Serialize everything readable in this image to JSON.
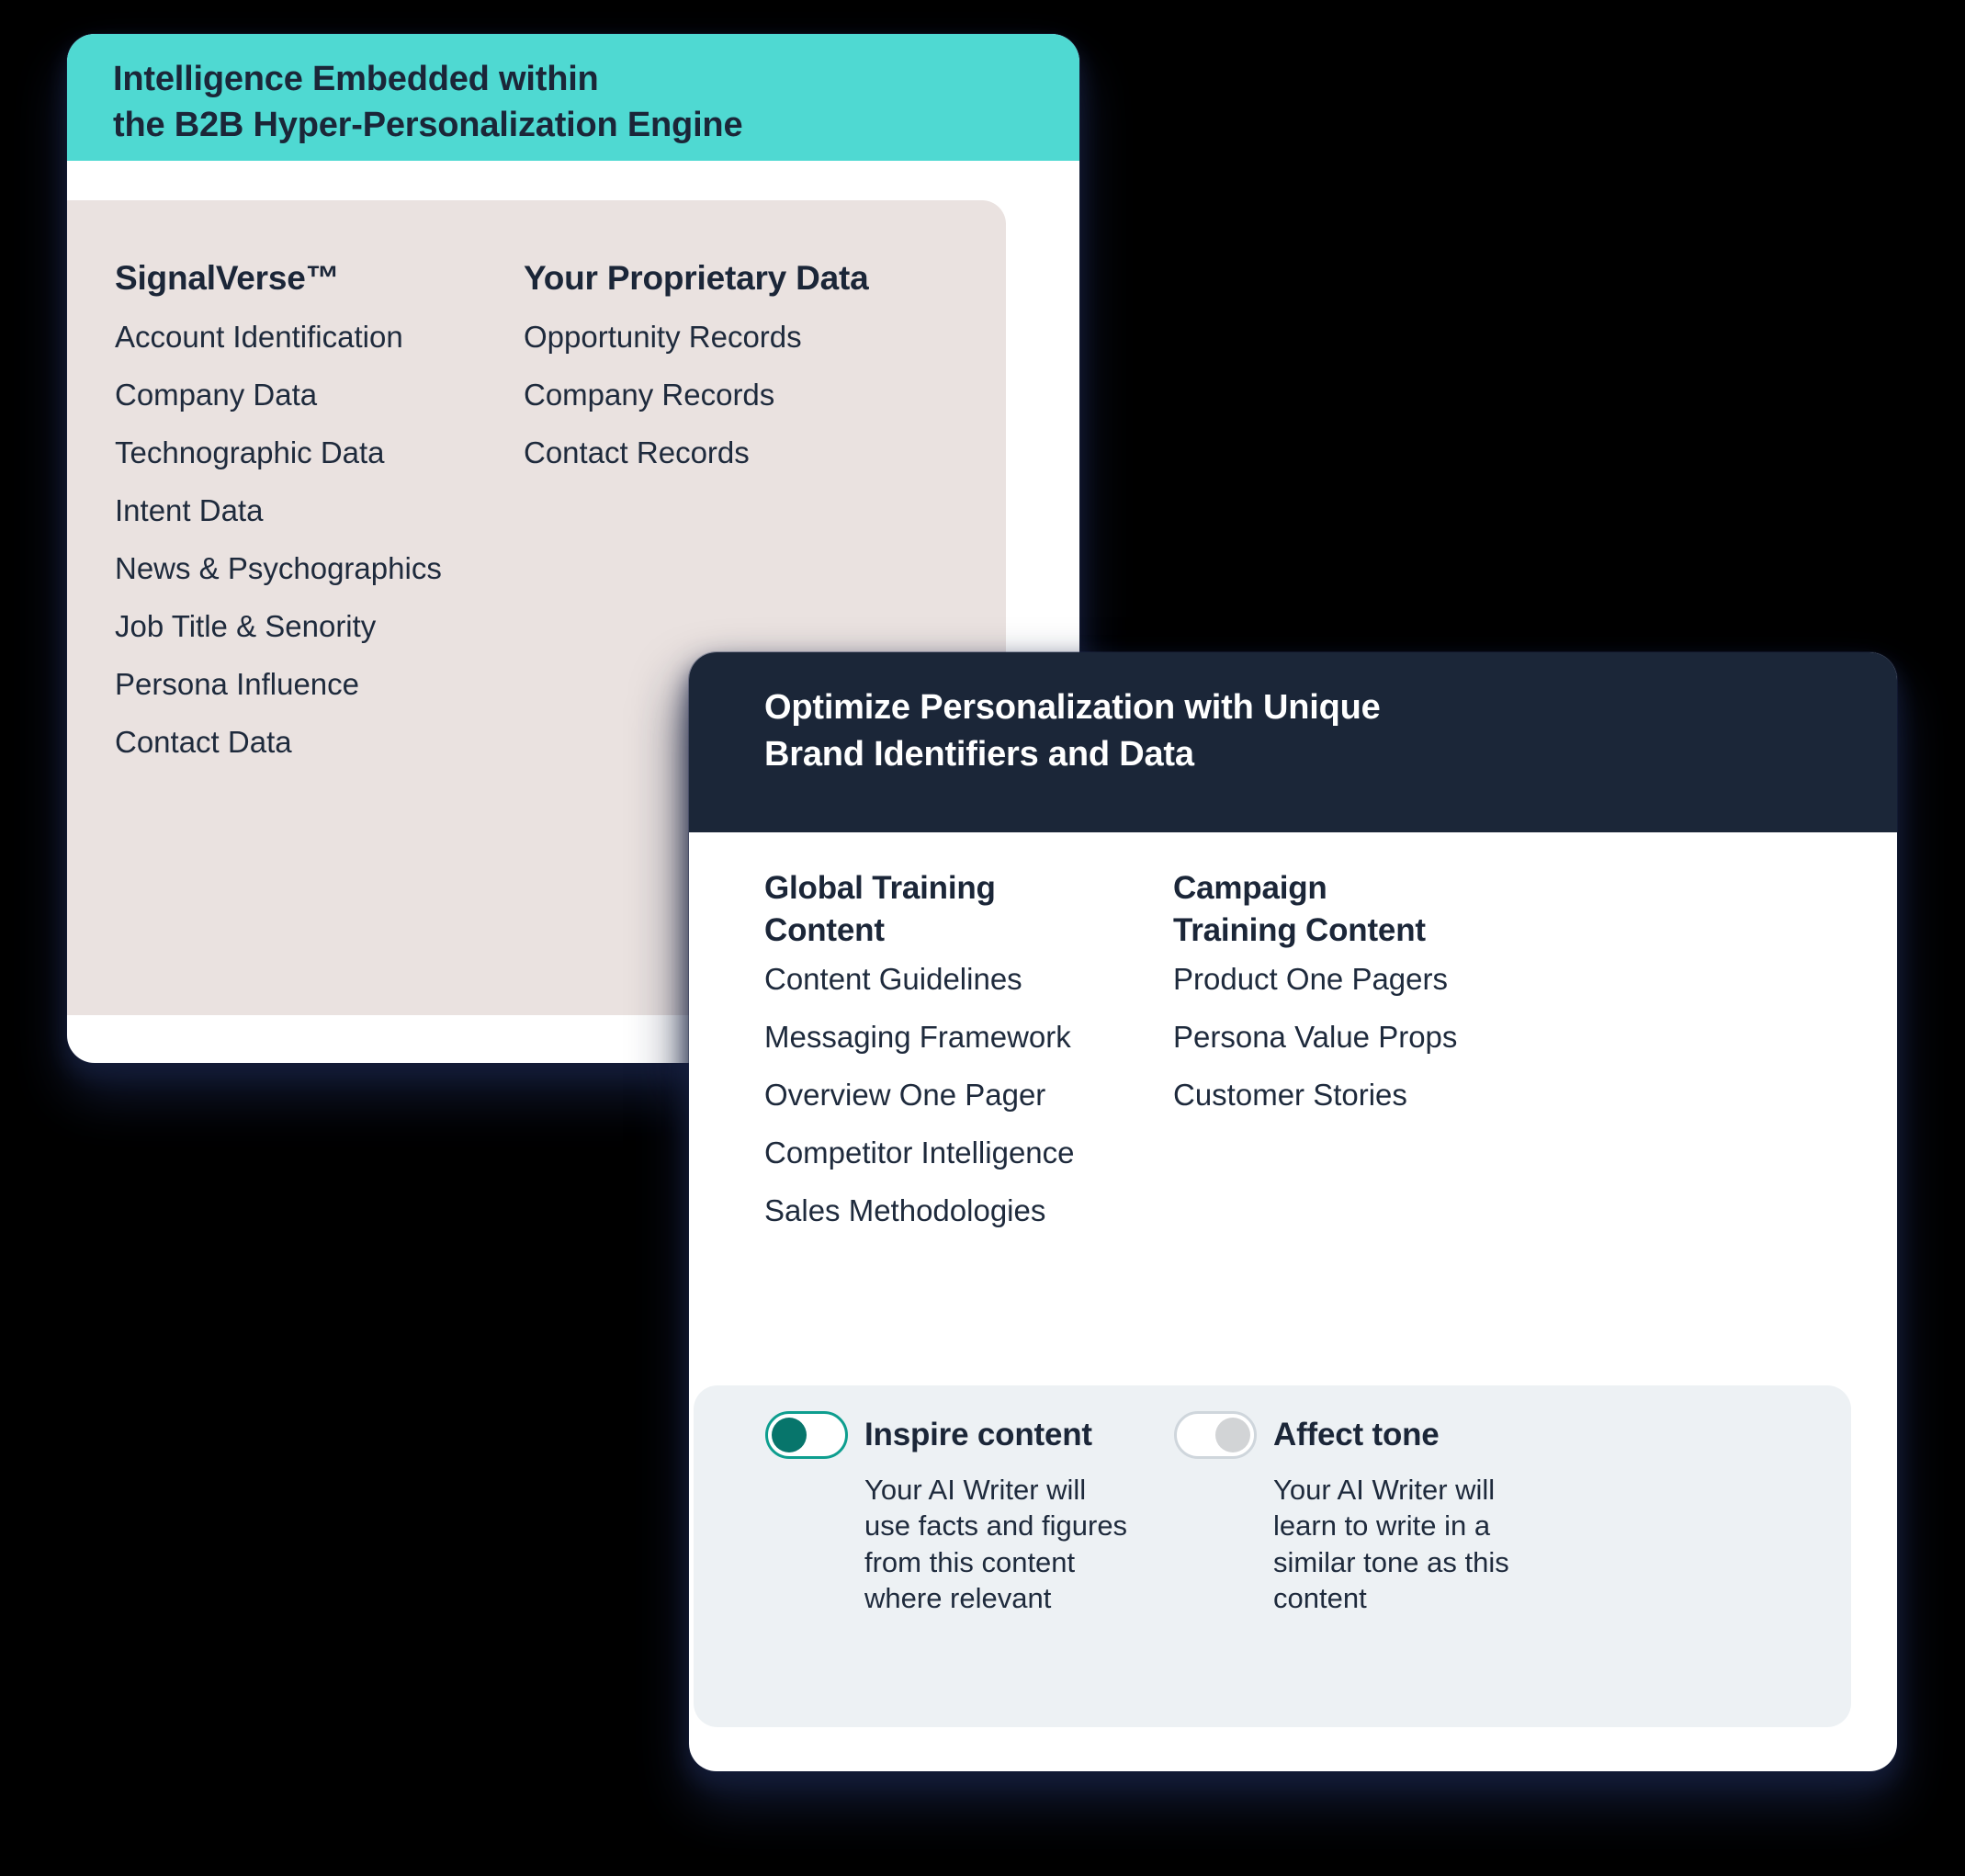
{
  "colors": {
    "background": "#000000",
    "card1_header_teal": "#4FD9D2",
    "beige_panel": "#EAE2E0",
    "card2_header_navy": "#1B2638",
    "footer_panel": "#EDF1F4",
    "toggle_on_border": "#0E9E8F",
    "toggle_on_knob": "#07756B",
    "toggle_off_border": "#CFD6DC",
    "toggle_off_knob": "#D2D4D6",
    "text_dark": "#1E2A3C",
    "text_light": "#FFFFFF"
  },
  "card1": {
    "title": "Intelligence Embedded within\nthe B2B Hyper-Personalization Engine",
    "columns": [
      {
        "title": "SignalVerse™",
        "items": [
          "Account Identification",
          "Company Data",
          "Technographic Data",
          "Intent Data",
          "News & Psychographics",
          "Job Title & Senority",
          "Persona Influence",
          "Contact Data"
        ]
      },
      {
        "title": "Your Proprietary Data",
        "items": [
          "Opportunity Records",
          "Company Records",
          "Contact Records"
        ]
      }
    ]
  },
  "card2": {
    "title": "Optimize Personalization with Unique\nBrand Identifiers and Data",
    "columns": [
      {
        "title": "Global Training Content",
        "items": [
          "Content Guidelines",
          "Messaging Framework",
          "Overview One Pager",
          "Competitor Intelligence",
          "Sales Methodologies"
        ]
      },
      {
        "title": "Campaign Training Content",
        "items": [
          "Product One Pagers",
          "Persona Value Props",
          "Customer Stories"
        ]
      }
    ],
    "toggles": [
      {
        "label": "Inspire content",
        "state": "on",
        "description": "Your AI Writer will\nuse facts and figures\nfrom this content\nwhere relevant"
      },
      {
        "label": "Affect tone",
        "state": "off",
        "description": "Your AI Writer will\nlearn to write in a\nsimilar tone as this\ncontent"
      }
    ]
  }
}
